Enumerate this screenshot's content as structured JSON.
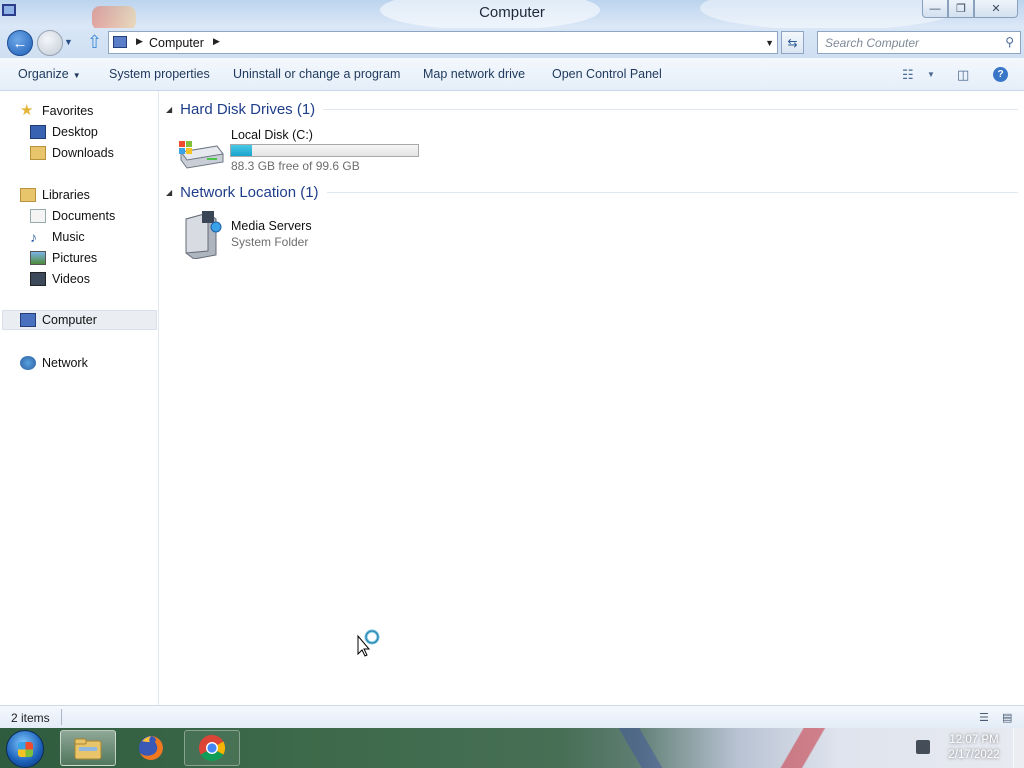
{
  "window": {
    "title": "Computer",
    "buttons": {
      "minimize": "—",
      "maximize": "❐",
      "close": "✕"
    }
  },
  "address": {
    "crumb": "Computer",
    "search_placeholder": "Search Computer"
  },
  "commands": {
    "organize": "Organize",
    "system_properties": "System properties",
    "uninstall": "Uninstall or change a program",
    "map_drive": "Map network drive",
    "control_panel": "Open Control Panel"
  },
  "sidebar": {
    "favorites": "Favorites",
    "desktop": "Desktop",
    "downloads": "Downloads",
    "libraries": "Libraries",
    "documents": "Documents",
    "music": "Music",
    "pictures": "Pictures",
    "videos": "Videos",
    "computer": "Computer",
    "network": "Network"
  },
  "groups": {
    "hard_disks": {
      "header": "Hard Disk Drives (1)",
      "items": [
        {
          "name": "Local Disk (C:)",
          "detail": "88.3 GB free of 99.6 GB",
          "used_fraction": 0.113
        }
      ]
    },
    "network_location": {
      "header": "Network Location (1)",
      "items": [
        {
          "name": "Media Servers",
          "detail": "System Folder"
        }
      ]
    }
  },
  "status": {
    "count": "2 items"
  },
  "taskbar": {
    "apps": [
      "explorer-icon",
      "firefox-icon",
      "chrome-icon"
    ],
    "time": "12:07 PM",
    "date": "2/17/2022"
  },
  "colors": {
    "accent": "#1e3e8a",
    "progress": "#26b0d6"
  }
}
